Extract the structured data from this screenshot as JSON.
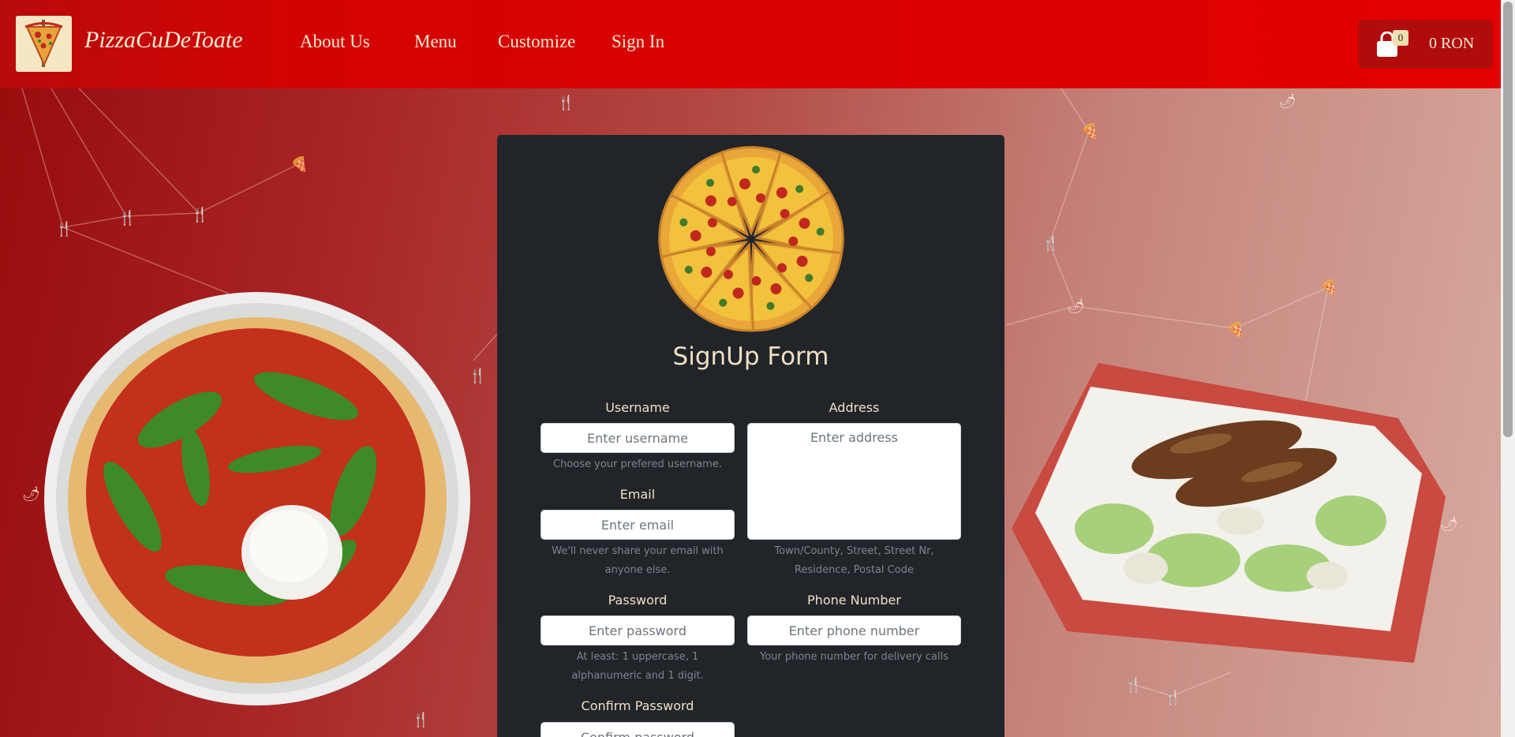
{
  "navbar": {
    "brand": "PizzaCuDeToate",
    "links": [
      "About Us",
      "Menu",
      "Customize",
      "Sign In"
    ],
    "cart_count": "0",
    "cart_total": "0 RON"
  },
  "form": {
    "title": "SignUp Form",
    "username": {
      "label": "Username",
      "placeholder": "Enter username",
      "help": "Choose your prefered username."
    },
    "email": {
      "label": "Email",
      "placeholder": "Enter email",
      "help": "We'll never share your email with anyone else."
    },
    "password": {
      "label": "Password",
      "placeholder": "Enter password",
      "help": "At least: 1 uppercase, 1 alphanumeric and 1 digit."
    },
    "confirm_password": {
      "label": "Confirm Password",
      "placeholder": "Confirm password"
    },
    "address": {
      "label": "Address",
      "placeholder": "Enter address",
      "help": "Town/County, Street, Street Nr, Residence, Postal Code"
    },
    "phone": {
      "label": "Phone Number",
      "placeholder": "Enter phone number",
      "help": "Your phone number for delivery calls"
    }
  },
  "colors": {
    "navbar": "#e30000",
    "card": "#212529",
    "label_text": "#f2dfc4",
    "help_text": "#7c858e"
  }
}
